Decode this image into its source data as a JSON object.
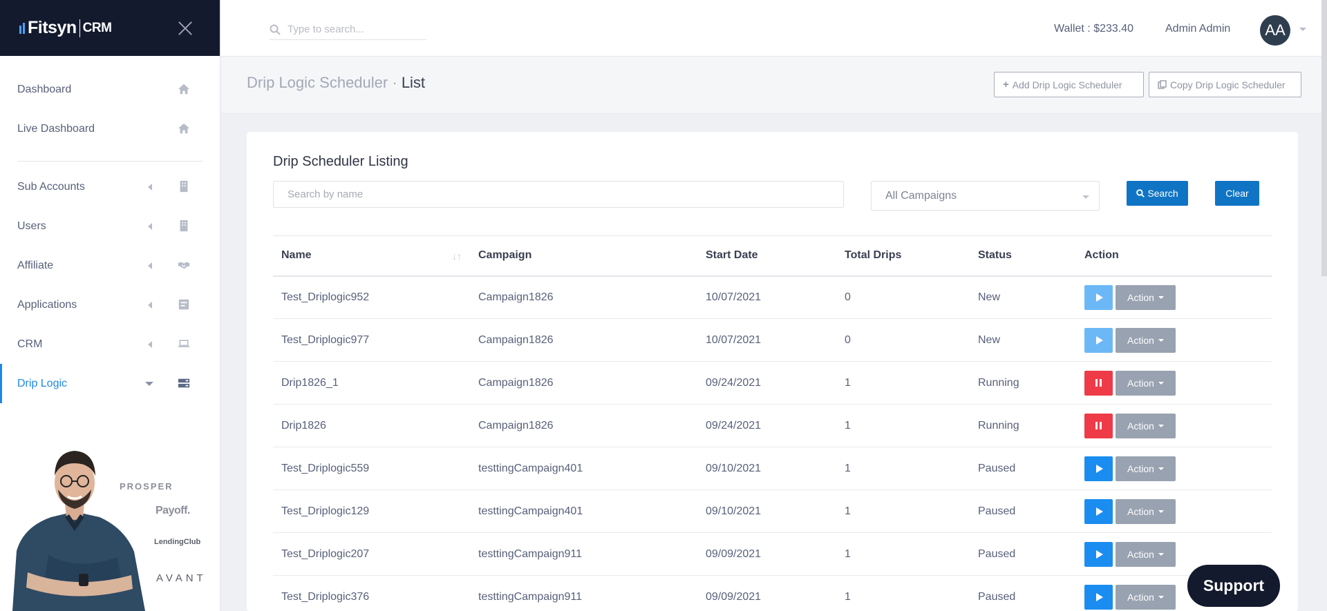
{
  "brand": {
    "name": "Fitsyn",
    "suffix": "CRM"
  },
  "sidebar": {
    "items": [
      {
        "label": "Dashboard",
        "icon": "home-icon"
      },
      {
        "label": "Live Dashboard",
        "icon": "home-icon"
      },
      {
        "label": "Sub Accounts",
        "icon": "building-icon"
      },
      {
        "label": "Users",
        "icon": "building-icon"
      },
      {
        "label": "Affiliate",
        "icon": "handshake-icon"
      },
      {
        "label": "Applications",
        "icon": "form-icon"
      },
      {
        "label": "CRM",
        "icon": "laptop-icon"
      },
      {
        "label": "Drip Logic",
        "icon": "server-icon"
      }
    ],
    "active": "Drip Logic",
    "promo_brands": [
      "PROSPER",
      "Payoff.",
      "LendingClub",
      "AVANT"
    ]
  },
  "header": {
    "search_placeholder": "Type to search...",
    "wallet": "Wallet : $233.40",
    "user_name": "Admin Admin",
    "avatar_initials": "AA"
  },
  "page": {
    "breadcrumb_parent": "Drip Logic Scheduler",
    "breadcrumb_sep": "·",
    "breadcrumb_current": "List",
    "add_button": "Add Drip Logic Scheduler",
    "copy_button": "Copy Drip Logic Scheduler"
  },
  "listing": {
    "title": "Drip Scheduler Listing",
    "search_placeholder": "Search by name",
    "campaign_filter": "All Campaigns",
    "search_button": "Search",
    "clear_button": "Clear",
    "columns": [
      "Name",
      "Campaign",
      "Start Date",
      "Total Drips",
      "Status",
      "Action"
    ],
    "rows": [
      {
        "name": "Test_Driplogic952",
        "campaign": "Campaign1826",
        "start_date": "10/07/2021",
        "total_drips": "0",
        "status": "New",
        "control": "play-disabled",
        "action": "Action"
      },
      {
        "name": "Test_Driplogic977",
        "campaign": "Campaign1826",
        "start_date": "10/07/2021",
        "total_drips": "0",
        "status": "New",
        "control": "play-disabled",
        "action": "Action"
      },
      {
        "name": "Drip1826_1",
        "campaign": "Campaign1826",
        "start_date": "09/24/2021",
        "total_drips": "1",
        "status": "Running",
        "control": "pause",
        "action": "Action"
      },
      {
        "name": "Drip1826",
        "campaign": "Campaign1826",
        "start_date": "09/24/2021",
        "total_drips": "1",
        "status": "Running",
        "control": "pause",
        "action": "Action"
      },
      {
        "name": "Test_Driplogic559",
        "campaign": "testtingCampaign401",
        "start_date": "09/10/2021",
        "total_drips": "1",
        "status": "Paused",
        "control": "play",
        "action": "Action"
      },
      {
        "name": "Test_Driplogic129",
        "campaign": "testtingCampaign401",
        "start_date": "09/10/2021",
        "total_drips": "1",
        "status": "Paused",
        "control": "play",
        "action": "Action"
      },
      {
        "name": "Test_Driplogic207",
        "campaign": "testtingCampaign911",
        "start_date": "09/09/2021",
        "total_drips": "1",
        "status": "Paused",
        "control": "play",
        "action": "Action"
      },
      {
        "name": "Test_Driplogic376",
        "campaign": "testtingCampaign911",
        "start_date": "09/09/2021",
        "total_drips": "1",
        "status": "Paused",
        "control": "play",
        "action": "Action"
      }
    ]
  },
  "support_label": "Support",
  "colors": {
    "accent": "#1e88e5",
    "primary_button": "#1074c4",
    "danger": "#ef3b47",
    "sidebar_brand_bg": "#141a2e"
  }
}
